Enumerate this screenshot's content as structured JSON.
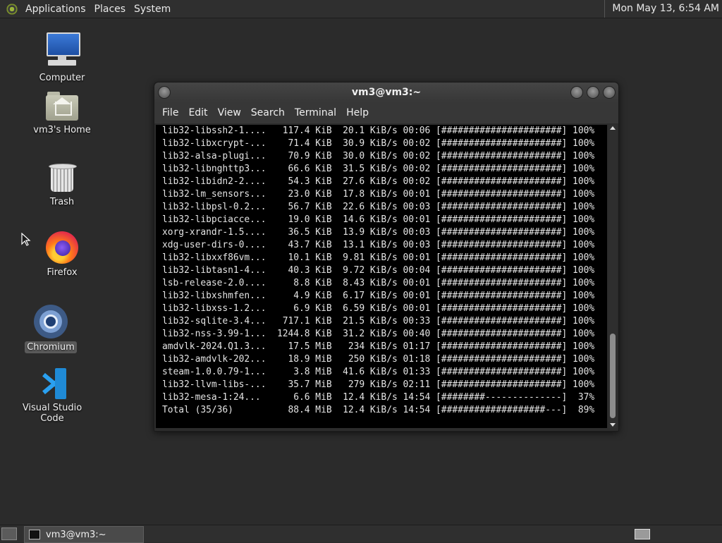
{
  "top_panel": {
    "menus": [
      "Applications",
      "Places",
      "System"
    ],
    "clock": "Mon May 13,  6:54 AM"
  },
  "desktop_icons": {
    "computer": "Computer",
    "home": "vm3's Home",
    "trash": "Trash",
    "firefox": "Firefox",
    "chromium": "Chromium",
    "vscode": "Visual Studio Code"
  },
  "terminal": {
    "title": "vm3@vm3:~",
    "menu": [
      "File",
      "Edit",
      "View",
      "Search",
      "Terminal",
      "Help"
    ],
    "lines": [
      "lib32-libssh2-1....   117.4 KiB  20.1 KiB/s 00:06 [######################] 100%",
      "lib32-libxcrypt-...    71.4 KiB  30.9 KiB/s 00:02 [######################] 100%",
      "lib32-alsa-plugi...    70.9 KiB  30.0 KiB/s 00:02 [######################] 100%",
      "lib32-libnghttp3...    66.6 KiB  31.5 KiB/s 00:02 [######################] 100%",
      "lib32-libidn2-2....    54.3 KiB  27.6 KiB/s 00:02 [######################] 100%",
      "lib32-lm_sensors...    23.0 KiB  17.8 KiB/s 00:01 [######################] 100%",
      "lib32-libpsl-0.2...    56.7 KiB  22.6 KiB/s 00:03 [######################] 100%",
      "lib32-libpciacce...    19.0 KiB  14.6 KiB/s 00:01 [######################] 100%",
      "xorg-xrandr-1.5....    36.5 KiB  13.9 KiB/s 00:03 [######################] 100%",
      "xdg-user-dirs-0....    43.7 KiB  13.1 KiB/s 00:03 [######################] 100%",
      "lib32-libxxf86vm...    10.1 KiB  9.81 KiB/s 00:01 [######################] 100%",
      "lib32-libtasn1-4...    40.3 KiB  9.72 KiB/s 00:04 [######################] 100%",
      "lsb-release-2.0....     8.8 KiB  8.43 KiB/s 00:01 [######################] 100%",
      "lib32-libxshmfen...     4.9 KiB  6.17 KiB/s 00:01 [######################] 100%",
      "lib32-libxss-1.2...     6.9 KiB  6.59 KiB/s 00:01 [######################] 100%",
      "lib32-sqlite-3.4...   717.1 KiB  21.5 KiB/s 00:33 [######################] 100%",
      "lib32-nss-3.99-1...  1244.8 KiB  31.2 KiB/s 00:40 [######################] 100%",
      "amdvlk-2024.Q1.3...    17.5 MiB   234 KiB/s 01:17 [######################] 100%",
      "lib32-amdvlk-202...    18.9 MiB   250 KiB/s 01:18 [######################] 100%",
      "steam-1.0.0.79-1...     3.8 MiB  41.6 KiB/s 01:33 [######################] 100%",
      "lib32-llvm-libs-...    35.7 MiB   279 KiB/s 02:11 [######################] 100%",
      "lib32-mesa-1:24...      6.6 MiB  12.4 KiB/s 14:54 [########--------------]  37%",
      "Total (35/36)          88.4 MiB  12.4 KiB/s 14:54 [###################---]  89%"
    ]
  },
  "taskbar": {
    "task_label": "vm3@vm3:~"
  }
}
